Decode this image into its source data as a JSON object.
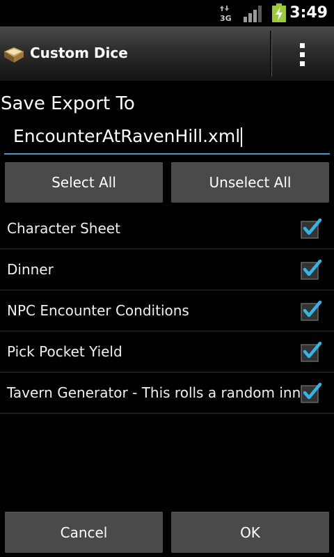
{
  "status_bar": {
    "time": "3:49",
    "network": "3G"
  },
  "action_bar": {
    "title": "Custom Dice"
  },
  "form": {
    "save_label": "Save Export To",
    "filename": "EncounterAtRavenHill.xml"
  },
  "buttons": {
    "select_all": "Select All",
    "unselect_all": "Unselect All",
    "cancel": "Cancel",
    "ok": "OK"
  },
  "items": [
    {
      "label": "Character Sheet",
      "checked": true
    },
    {
      "label": "Dinner",
      "checked": true
    },
    {
      "label": "NPC Encounter Conditions",
      "checked": true
    },
    {
      "label": "Pick Pocket Yield",
      "checked": true
    },
    {
      "label": "Tavern Generator - This rolls a random inn",
      "checked": true
    }
  ],
  "colors": {
    "accent": "#33a0c8",
    "battery": "#9ccb3a"
  }
}
